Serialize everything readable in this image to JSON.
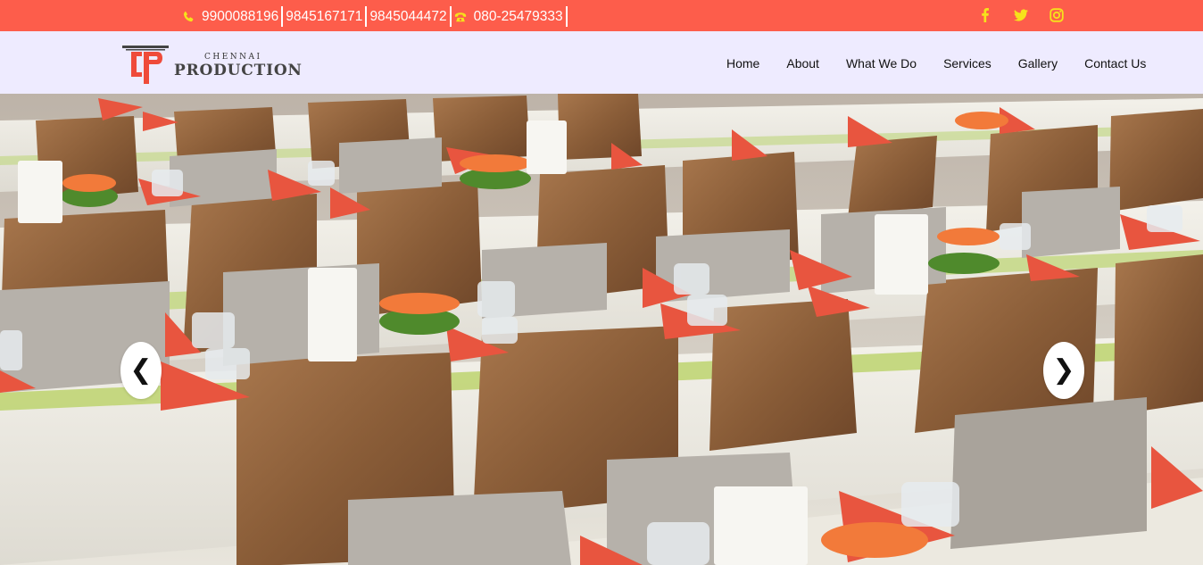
{
  "topbar": {
    "phones": [
      "9900088196",
      "9845167171",
      "9845044472"
    ],
    "landline": "080-25479333",
    "phone_icon": "phone-icon",
    "landline_icon": "telephone-icon",
    "social": [
      "facebook-icon",
      "twitter-icon",
      "instagram-icon"
    ],
    "bg_color": "#fd5d4b",
    "icon_color": "#f6e21b"
  },
  "header": {
    "logo_initials": "CP",
    "logo_small": "CHENNAI",
    "logo_big": "PRODUCTION",
    "bg_color": "#eeebff"
  },
  "nav": {
    "items": [
      "Home",
      "About",
      "What We Do",
      "Services",
      "Gallery",
      "Contact Us"
    ]
  },
  "slider": {
    "prev_label": "❮",
    "next_label": "❯"
  }
}
